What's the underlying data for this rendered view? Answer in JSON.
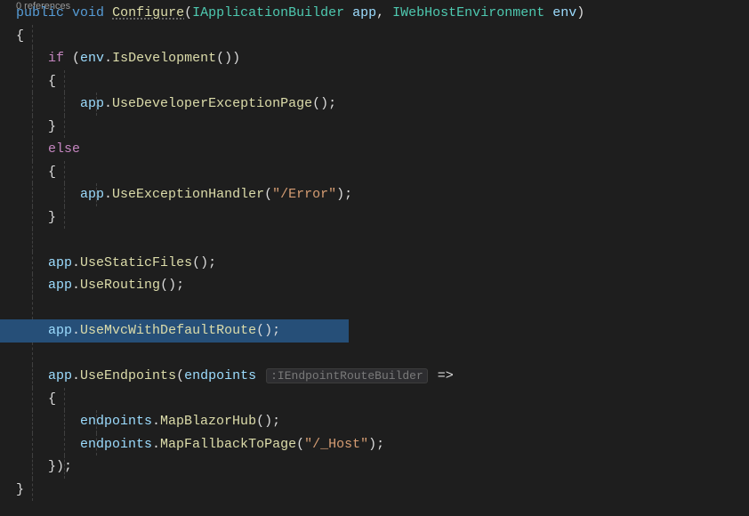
{
  "codelens": "0 references",
  "line1": {
    "kw_public": "public",
    "kw_void": "void",
    "method": "Configure",
    "p_open": "(",
    "type1": "IApplicationBuilder",
    "param1": "app",
    "comma": ", ",
    "type2": "IWebHostEnvironment",
    "param2": "env",
    "p_close": ")"
  },
  "line2": {
    "brace": "{"
  },
  "line3": {
    "ctrl_if": "if",
    "p_open": " (",
    "ident": "env",
    "dot": ".",
    "method": "IsDevelopment",
    "call": "())"
  },
  "line4": {
    "brace": "    {"
  },
  "line5": {
    "pad": "        ",
    "ident": "app",
    "dot": ".",
    "method": "UseDeveloperExceptionPage",
    "call": "();"
  },
  "line6": {
    "brace": "    }"
  },
  "line7": {
    "pad": "    ",
    "ctrl_else": "else"
  },
  "line8": {
    "brace": "    {"
  },
  "line9": {
    "pad": "        ",
    "ident": "app",
    "dot": ".",
    "method": "UseExceptionHandler",
    "open": "(",
    "str": "\"/Error\"",
    "close": ");"
  },
  "line10": {
    "brace": "    }"
  },
  "line12": {
    "pad": "    ",
    "ident": "app",
    "dot": ".",
    "method": "UseStaticFiles",
    "call": "();"
  },
  "line13": {
    "pad": "    ",
    "ident": "app",
    "dot": ".",
    "method": "UseRouting",
    "call": "();"
  },
  "line15": {
    "pad": "    ",
    "ident": "app",
    "dot": ".",
    "method": "UseMvcWithDefaultRoute",
    "call": "();"
  },
  "line17": {
    "pad": "    ",
    "ident": "app",
    "dot": ".",
    "method": "UseEndpoints",
    "open": "(",
    "param": "endpoints",
    "hint": ":IEndpointRouteBuilder",
    "arrow": " =>"
  },
  "line18": {
    "brace": "    {"
  },
  "line19": {
    "pad": "        ",
    "ident": "endpoints",
    "dot": ".",
    "method": "MapBlazorHub",
    "call": "();"
  },
  "line20": {
    "pad": "        ",
    "ident": "endpoints",
    "dot": ".",
    "method": "MapFallbackToPage",
    "open": "(",
    "str": "\"/_Host\"",
    "close": ");"
  },
  "line21": {
    "brace": "    });"
  },
  "line22": {
    "brace": "}"
  }
}
